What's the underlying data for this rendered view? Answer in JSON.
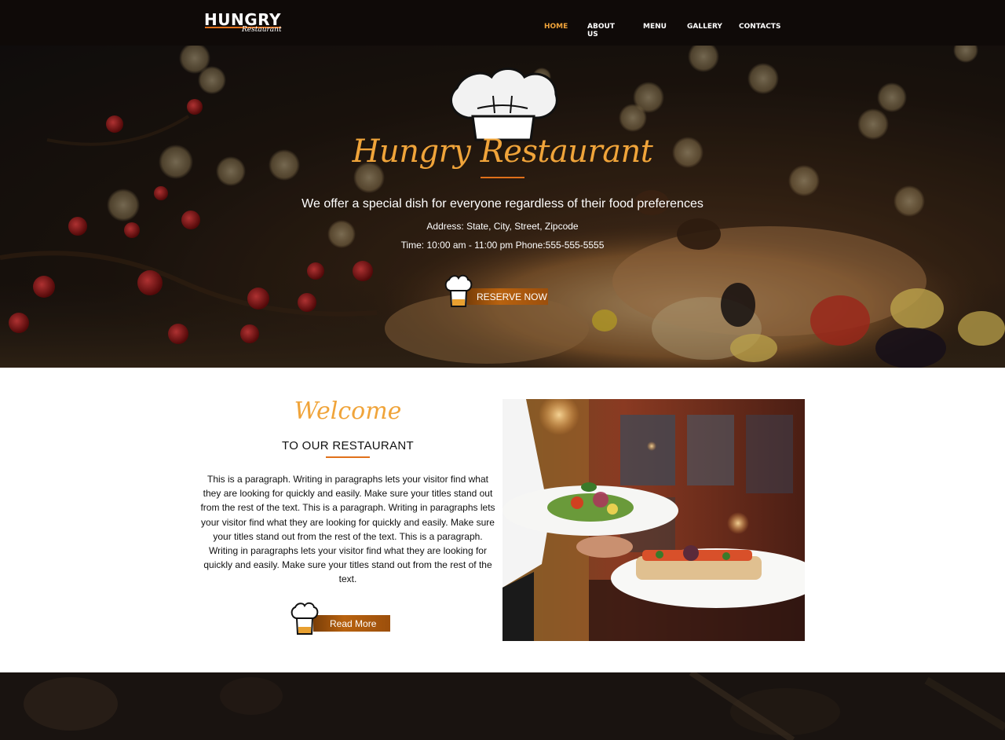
{
  "brand": {
    "name": "HUNGRY",
    "tagline": "Restaurant"
  },
  "nav": {
    "items": [
      {
        "label": "HOME",
        "active": true
      },
      {
        "label": "ABOUT US",
        "active": false
      },
      {
        "label": "MENU",
        "active": false
      },
      {
        "label": "GALLERY",
        "active": false
      },
      {
        "label": "CONTACTS",
        "active": false
      }
    ]
  },
  "hero": {
    "title": "Hungry Restaurant",
    "tagline": "We offer a special dish for everyone regardless of their food preferences",
    "address": "Address: State, City, Street, Zipcode",
    "time": "Time: 10:00 am - 11:00 pm Phone:555-555-5555",
    "button_label": "RESERVE NOW"
  },
  "welcome": {
    "title": "Welcome",
    "subtitle": "TO OUR RESTAURANT",
    "paragraph": "This is a paragraph. Writing in paragraphs lets your visitor find what they are looking for quickly and easily. Make sure your titles stand out from the rest of the text. This is a paragraph. Writing in paragraphs lets your visitor find what they are looking for quickly and easily. Make sure your titles stand out from the rest of the text. This is a paragraph. Writing in paragraphs lets your visitor find what they are looking for quickly and easily. Make sure your titles stand out from the rest of the text.",
    "button_label": "Read More"
  },
  "colors": {
    "accent": "#f0a43a",
    "accent_dark": "#e0701a",
    "button_brown": "#b8620f",
    "nav_bg": "#0f0a08"
  },
  "icons": {
    "hero_hat": "chef-hat-icon",
    "button_hat": "chef-hat-icon"
  }
}
